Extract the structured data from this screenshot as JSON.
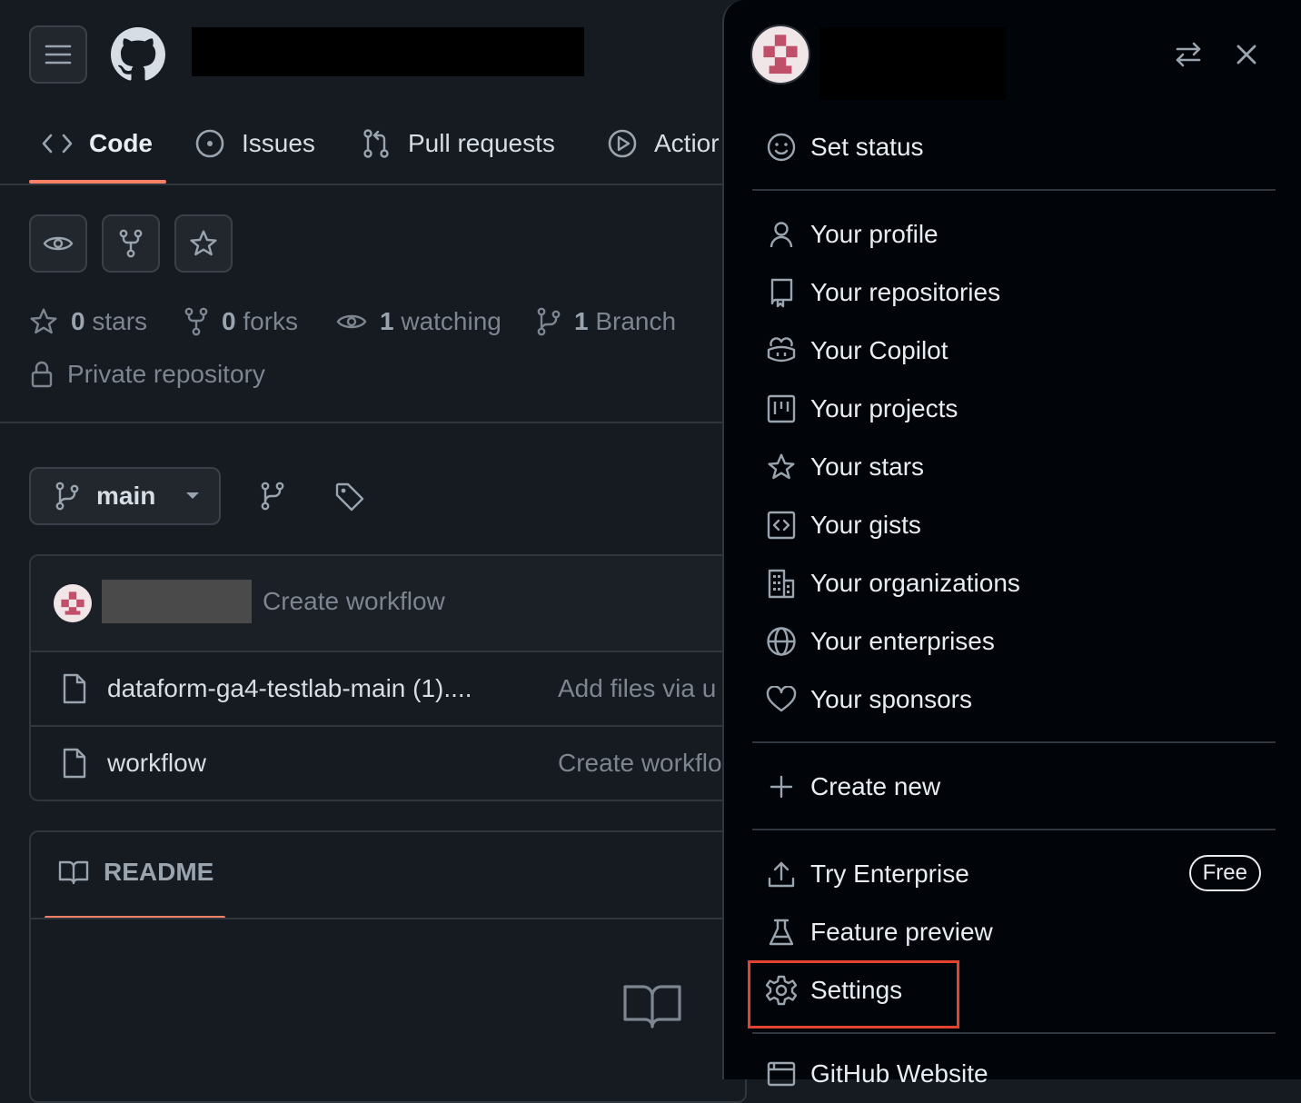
{
  "repo": {
    "tabs": [
      {
        "label": "Code"
      },
      {
        "label": "Issues"
      },
      {
        "label": "Pull requests"
      },
      {
        "label": "Actior"
      }
    ],
    "stats": {
      "stars_count": "0",
      "stars_label": "stars",
      "forks_count": "0",
      "forks_label": "forks",
      "watching_count": "1",
      "watching_label": "watching",
      "branch_count": "1",
      "branch_label": "Branch"
    },
    "visibility": "Private repository",
    "branch_selector": "main",
    "commit_message": "Create workflow",
    "files": [
      {
        "name": "dataform-ga4-testlab-main (1)....",
        "commit": "Add files via u"
      },
      {
        "name": "workflow",
        "commit": "Create workflo"
      }
    ],
    "readme_tab": "README"
  },
  "user_menu": {
    "set_status": "Set status",
    "group1": [
      {
        "label": "Your profile",
        "icon": "person-icon"
      },
      {
        "label": "Your repositories",
        "icon": "repo-icon"
      },
      {
        "label": "Your Copilot",
        "icon": "copilot-icon"
      },
      {
        "label": "Your projects",
        "icon": "project-icon"
      },
      {
        "label": "Your stars",
        "icon": "star-icon"
      },
      {
        "label": "Your gists",
        "icon": "code-square-icon"
      },
      {
        "label": "Your organizations",
        "icon": "organization-icon"
      },
      {
        "label": "Your enterprises",
        "icon": "globe-icon"
      },
      {
        "label": "Your sponsors",
        "icon": "heart-icon"
      }
    ],
    "create_new": "Create new",
    "try_enterprise": "Try Enterprise",
    "free_badge": "Free",
    "feature_preview": "Feature preview",
    "settings": "Settings",
    "github_website": "GitHub Website"
  },
  "colors": {
    "highlight_box": "#e0432e",
    "tab_underline": "#f78166",
    "panel_bg": "#010409",
    "page_bg": "#161a21"
  }
}
